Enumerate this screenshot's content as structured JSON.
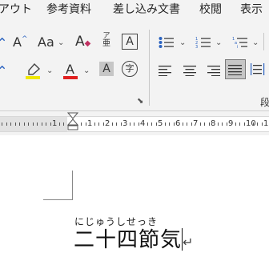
{
  "tabs": [
    "アウト",
    "参考資料",
    "差し込み文書",
    "校閲",
    "表示"
  ],
  "font_group": {
    "grow": "A",
    "shrink": "A",
    "change_case": "Aa",
    "clear_format": "A",
    "phonetic_top": "ア",
    "phonetic_bottom": "亜",
    "char_border": "A",
    "char_shading": "A",
    "enclose_char": "字",
    "font_color_letter": "A",
    "font_color": "#e02020",
    "highlight_color": "#f0e800"
  },
  "paragraph_group": {
    "label": "段"
  },
  "ruler": {
    "numbers": [
      "1",
      "1",
      "2",
      "3",
      "4",
      "5",
      "6",
      "7",
      "8",
      "9",
      "10",
      "11"
    ]
  },
  "document": {
    "ruby": "にじゅうしせっき",
    "text": "二十四節気",
    "return_mark": "↵"
  }
}
